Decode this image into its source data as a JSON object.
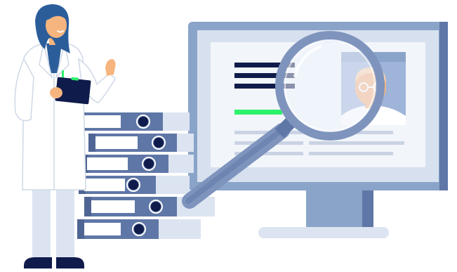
{
  "scene": {
    "kind": "illustration",
    "colors": {
      "background": "#ffffff",
      "navy": "#0f1b4a",
      "monitor_frame": "#8aa3c8",
      "monitor_shadow": "#5f77a6",
      "screen": "#d7e0ef",
      "document": "#f2f5fa",
      "text_line": "#0f1b4a",
      "placeholder_line": "#c9d3e4",
      "accent_green": "#2cf26b",
      "photo_bg": "#9fb4d9",
      "skin": "#f6b47f",
      "hair": "#f6b47f",
      "lens_ring": "#7e94bd",
      "lens_glass": "#eef3fb",
      "binder_dark": "#5f77a6",
      "binder_light": "#dce4f1",
      "coat": "#ffffff",
      "coat_line": "#cfd8e6",
      "scrubs": "#2b5d9a",
      "doctor_hair": "#2b5d9a",
      "clipboard": "#0f1b4a"
    },
    "icons": {
      "magnifier": "magnifier-icon",
      "monitor": "monitor-icon",
      "binders": "binder-icon",
      "doctor": "doctor-icon",
      "profile_photo": "profile-photo-icon",
      "clipboard": "clipboard-icon"
    }
  }
}
